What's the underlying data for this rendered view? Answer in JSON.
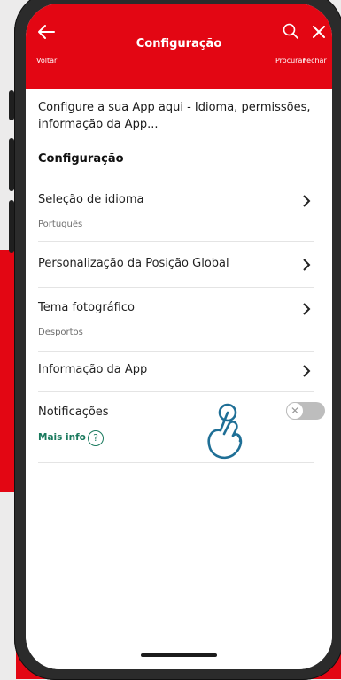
{
  "header": {
    "title": "Configuração",
    "back_label": "Voltar",
    "search_label": "Procurar",
    "close_label": "Fechar"
  },
  "intro_text": "Configure a sua App aqui - Idioma, permissões, informação da App...",
  "section_title": "Configuração",
  "settings": [
    {
      "label": "Seleção de idioma",
      "sub": "Português"
    },
    {
      "label": "Personalização da Posição Global",
      "sub": ""
    },
    {
      "label": "Tema fotográfico",
      "sub": "Desportos"
    },
    {
      "label": "Informação da App",
      "sub": ""
    }
  ],
  "notifications": {
    "label": "Notificações",
    "more_info": "Mais info",
    "help_symbol": "?",
    "enabled": false
  },
  "icons": [
    "arrow-left-icon",
    "search-icon",
    "close-icon",
    "chevron-right-icon",
    "question-icon",
    "hand-pointer-icon"
  ],
  "colors": {
    "brand": "#e30613",
    "link": "#1a7a5e",
    "hand": "#1f6f96"
  }
}
